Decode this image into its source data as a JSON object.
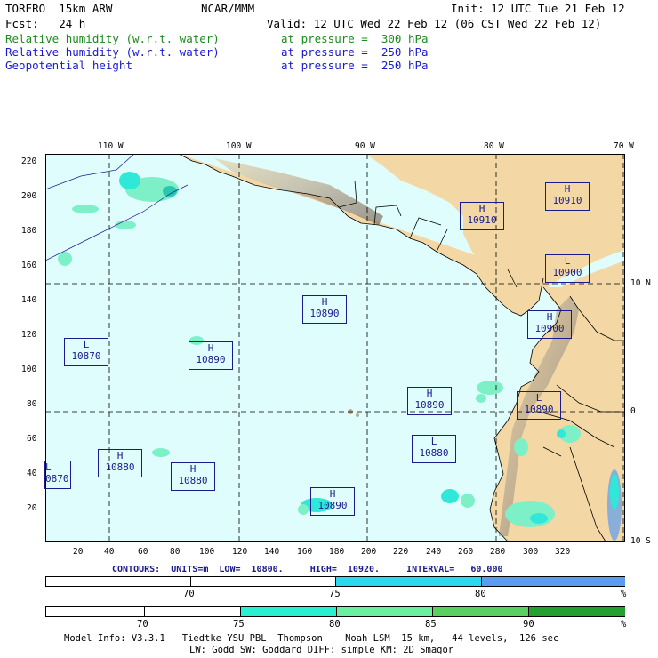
{
  "header": {
    "model": "TORERO  15km ARW",
    "org": "NCAR/MMM",
    "init": "Init: 12 UTC Tue 21 Feb 12",
    "fcst": "Fcst:   24 h",
    "valid": "Valid: 12 UTC Wed 22 Feb 12 (06 CST Wed 22 Feb 12)",
    "fields": [
      {
        "name": "Relative humidity (w.r.t. water)",
        "level": "at pressure =  300 hPa",
        "color": "#1f8a1f"
      },
      {
        "name": "Relative humidity (w.r.t. water)",
        "level": "at pressure =  250 hPa",
        "color": "#1a1ad0"
      },
      {
        "name": "Geopotential height",
        "level": "at pressure =  250 hPa",
        "color": "#1a1ad0"
      }
    ]
  },
  "map": {
    "lon_labels": [
      "110 W",
      "100 W",
      "90 W",
      "80 W",
      "70 W"
    ],
    "lat_labels": [
      "10 N",
      "0",
      "10 S"
    ],
    "y_ticks": [
      "220",
      "200",
      "180",
      "160",
      "140",
      "120",
      "100",
      "80",
      "60",
      "40",
      "20"
    ],
    "x_ticks": [
      "20",
      "40",
      "60",
      "80",
      "100",
      "120",
      "140",
      "160",
      "180",
      "200",
      "220",
      "240",
      "260",
      "280",
      "300",
      "320"
    ],
    "highs_lows": [
      {
        "type": "H",
        "value": "10910"
      },
      {
        "type": "H",
        "value": "10910"
      },
      {
        "type": "L",
        "value": "10900"
      },
      {
        "type": "H",
        "value": "10890"
      },
      {
        "type": "H",
        "value": "10900"
      },
      {
        "type": "L",
        "value": "10870"
      },
      {
        "type": "H",
        "value": "10890"
      },
      {
        "type": "H",
        "value": "10890"
      },
      {
        "type": "L",
        "value": "10890"
      },
      {
        "type": "L",
        "value": "10880"
      },
      {
        "type": "H",
        "value": "10880"
      },
      {
        "type": "H",
        "value": "10880"
      },
      {
        "type": "L",
        "value": "0870"
      },
      {
        "type": "H",
        "value": "10890"
      }
    ]
  },
  "contours_info": "CONTOURS:  UNITS=m  LOW=  10800.     HIGH=  10920.     INTERVAL=   60.000",
  "colorbar_250": {
    "labels": [
      "70",
      "75",
      "80",
      "%"
    ],
    "colors": [
      "#ffffff",
      "#ffffff",
      "#2ad8f0",
      "#5a9cf0"
    ]
  },
  "colorbar_300": {
    "labels": [
      "70",
      "75",
      "80",
      "85",
      "90",
      "%"
    ],
    "colors": [
      "#ffffff",
      "#ffffff",
      "#28f0d0",
      "#6af0a0",
      "#5ad060",
      "#22a030"
    ]
  },
  "footer": {
    "line1": "Model Info: V3.3.1   Tiedtke YSU PBL  Thompson    Noah LSM  15 km,   44 levels,  126 sec",
    "line2": "LW: Godd SW: Goddard DIFF: simple KM: 2D Smagor"
  }
}
